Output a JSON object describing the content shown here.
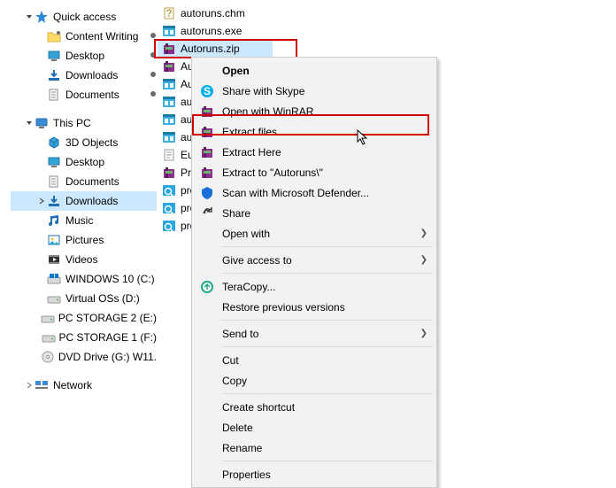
{
  "tree": {
    "quick_access": "Quick access",
    "qa_items": [
      {
        "label": "Content Writing",
        "icon": "folder-pin"
      },
      {
        "label": "Desktop",
        "icon": "desktop-pin"
      },
      {
        "label": "Downloads",
        "icon": "downloads-pin"
      },
      {
        "label": "Documents",
        "icon": "documents-pin"
      }
    ],
    "this_pc": "This PC",
    "pc_items": [
      {
        "label": "3D Objects",
        "icon": "3d"
      },
      {
        "label": "Desktop",
        "icon": "desktop"
      },
      {
        "label": "Documents",
        "icon": "documents"
      },
      {
        "label": "Downloads",
        "icon": "downloads",
        "selected": true
      },
      {
        "label": "Music",
        "icon": "music"
      },
      {
        "label": "Pictures",
        "icon": "pictures"
      },
      {
        "label": "Videos",
        "icon": "videos"
      },
      {
        "label": "WINDOWS 10 (C:)",
        "icon": "drive-win"
      },
      {
        "label": "Virtual OSs (D:)",
        "icon": "drive"
      },
      {
        "label": "PC STORAGE 2 (E:)",
        "icon": "drive"
      },
      {
        "label": "PC STORAGE 1 (F:)",
        "icon": "drive"
      },
      {
        "label": "DVD Drive (G:) W11.",
        "icon": "dvd"
      }
    ],
    "network": "Network"
  },
  "files": [
    {
      "label": "autoruns.chm",
      "icon": "chm"
    },
    {
      "label": "autoruns.exe",
      "icon": "exe-ar"
    },
    {
      "label": "Autoruns.zip",
      "icon": "winrar",
      "selected": true
    },
    {
      "label": "Au",
      "icon": "winrar"
    },
    {
      "label": "Au",
      "icon": "exe-ar"
    },
    {
      "label": "au",
      "icon": "exe-ar"
    },
    {
      "label": "aut",
      "icon": "exe-ar"
    },
    {
      "label": "aut",
      "icon": "exe-ar"
    },
    {
      "label": "Eu",
      "icon": "txt"
    },
    {
      "label": "Pr",
      "icon": "winrar"
    },
    {
      "label": "pro",
      "icon": "exe-pe"
    },
    {
      "label": "pro",
      "icon": "exe-pe"
    },
    {
      "label": "pro",
      "icon": "exe-pe"
    }
  ],
  "ctx": {
    "open": "Open",
    "share_skype": "Share with Skype",
    "open_winrar": "Open with WinRAR",
    "extract_files": "Extract files...",
    "extract_here": "Extract Here",
    "extract_to": "Extract to \"Autoruns\\\"",
    "scan_defender": "Scan with Microsoft Defender...",
    "share": "Share",
    "open_with": "Open with",
    "give_access": "Give access to",
    "teracopy": "TeraCopy...",
    "restore_versions": "Restore previous versions",
    "send_to": "Send to",
    "cut": "Cut",
    "copy": "Copy",
    "create_shortcut": "Create shortcut",
    "delete": "Delete",
    "rename": "Rename",
    "properties": "Properties"
  }
}
